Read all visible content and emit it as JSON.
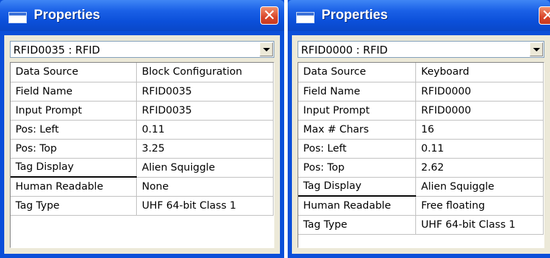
{
  "colors": {
    "title_blue": "#0b4fd9",
    "close_red": "#d9462a",
    "panel": "#ece9d8"
  },
  "icons": {
    "window": "window-icon",
    "close": "close-icon",
    "dropdown": "dropdown-arrow-icon"
  },
  "left": {
    "title": "Properties",
    "close_glyph": "✕",
    "select_value": "RFID0035 : RFID",
    "rows": [
      {
        "name": "Data Source",
        "value": "Block Configuration"
      },
      {
        "name": "Field Name",
        "value": "RFID0035"
      },
      {
        "name": "Input Prompt",
        "value": "RFID0035"
      },
      {
        "name": "Pos: Left",
        "value": "0.11"
      },
      {
        "name": "Pos: Top",
        "value": "3.25"
      },
      {
        "name": "Tag Display",
        "value": "Alien Squiggle"
      },
      {
        "name": "Human Readable",
        "value": "None"
      },
      {
        "name": "Tag Type",
        "value": "UHF 64-bit Class 1"
      }
    ]
  },
  "right": {
    "title": "Properties",
    "close_glyph": "✕",
    "select_value": "RFID0000 : RFID",
    "rows": [
      {
        "name": "Data Source",
        "value": "Keyboard"
      },
      {
        "name": "Field Name",
        "value": "RFID0000"
      },
      {
        "name": "Input Prompt",
        "value": "RFID0000"
      },
      {
        "name": "Max # Chars",
        "value": "16"
      },
      {
        "name": "Pos: Left",
        "value": "0.11"
      },
      {
        "name": "Pos: Top",
        "value": "2.62"
      },
      {
        "name": "Tag Display",
        "value": "Alien Squiggle"
      },
      {
        "name": "Human Readable",
        "value": "Free floating"
      },
      {
        "name": "Tag Type",
        "value": "UHF 64-bit Class 1"
      }
    ]
  }
}
